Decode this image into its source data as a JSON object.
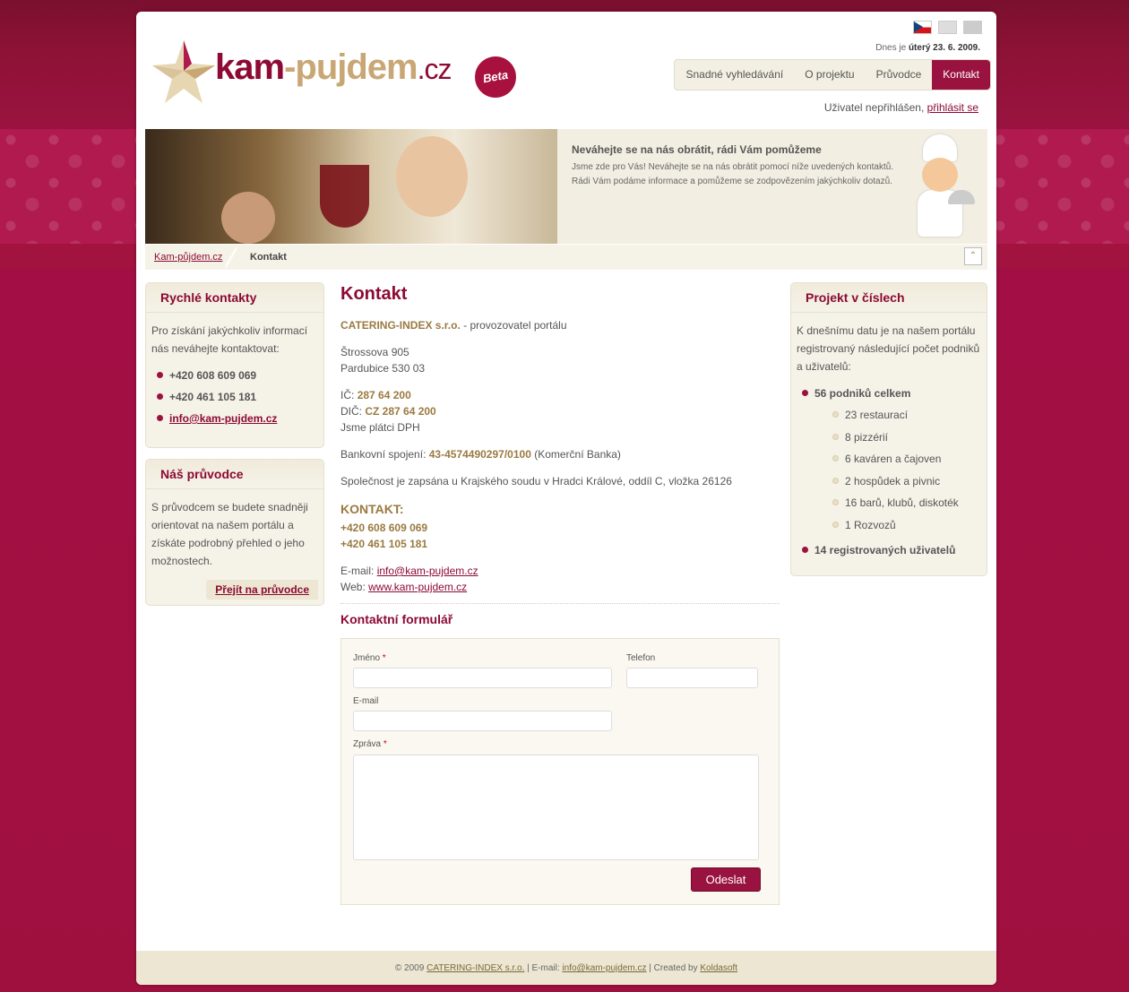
{
  "header": {
    "logo_part1": "kam",
    "logo_dash": "-",
    "logo_part2": "pujdem",
    "logo_tld": ".cz",
    "beta": "Beta",
    "date_prefix": "Dnes je",
    "date_value": "úterý 23. 6. 2009.",
    "login_text": "Uživatel nepřihlášen,",
    "login_link": "přihlásit se"
  },
  "nav": {
    "items": [
      "Snadné vyhledávání",
      "O projektu",
      "Průvodce",
      "Kontakt"
    ],
    "active": "Kontakt"
  },
  "banner": {
    "title": "Neváhejte se na nás obrátit, rádi Vám pomůžeme",
    "text": "Jsme zde pro Vás! Neváhejte se na nás obrátit pomocí níže uvedených kontaktů. Rádi Vám podáme informace a pomůžeme se zodpovězením jakýchkoliv dotazů."
  },
  "breadcrumb": {
    "home": "Kam-půjdem.cz",
    "current": "Kontakt"
  },
  "left": {
    "quick_title": "Rychlé kontakty",
    "quick_text": "Pro získání jakýchkoliv informací nás neváhejte kontaktovat:",
    "phone1": "+420 608 609 069",
    "phone2": "+420 461 105 181",
    "email": "info@kam-pujdem.cz",
    "guide_title": "Náš průvodce",
    "guide_text": "S průvodcem se budete snadněji orientovat na našem portálu a získáte podrobný přehled o jeho možnostech.",
    "guide_link": "Přejít na průvodce"
  },
  "main": {
    "title": "Kontakt",
    "company": "CATERING-INDEX s.r.o.",
    "company_suffix": " - provozovatel portálu",
    "street": "Štrossova 905",
    "city": "Pardubice 530 03",
    "ic_label": "IČ:",
    "ic": "287 64 200",
    "dic_label": "DIČ:",
    "dic": "CZ 287 64 200",
    "vat": "Jsme plátci DPH",
    "bank_label": "Bankovní spojení:",
    "bank": "43-4574490297/0100",
    "bank_name": " (Komerční Banka)",
    "register": "Společnost je zapsána u Krajského soudu v Hradci Králové, oddíl C, vložka 26126",
    "contact_heading": "KONTAKT:",
    "phone1": "+420 608 609 069",
    "phone2": "+420 461 105 181",
    "email_label": "E-mail:",
    "email": "info@kam-pujdem.cz",
    "web_label": "Web:",
    "web": "www.kam-pujdem.cz",
    "form_title": "Kontaktní formulář"
  },
  "form": {
    "name_label": "Jméno",
    "phone_label": "Telefon",
    "email_label": "E-mail",
    "message_label": "Zpráva",
    "required": "*",
    "submit": "Odeslat"
  },
  "right": {
    "title": "Projekt v číslech",
    "text": "K dnešnímu datu je na našem portálu registrovaný následující počet podniků a uživatelů:",
    "venues_total": "56 podniků celkem",
    "venues": [
      "23 restaurací",
      "8 pizzérií",
      "6 kaváren a čajoven",
      "2 hospůdek a pivnic",
      "16 barů, klubů, diskoték",
      "1 Rozvozů"
    ],
    "users": "14 registrovaných uživatelů"
  },
  "footer": {
    "copyright": "© 2009",
    "company": "CATERING-INDEX s.r.o.",
    "email_label": "| E-mail:",
    "email": "info@kam-pujdem.cz",
    "created_label": "| Created by",
    "created": "Koldasoft"
  },
  "colors": {
    "brand": "#8c0a33",
    "gold": "#9a7a40",
    "background": "#9a1340"
  }
}
